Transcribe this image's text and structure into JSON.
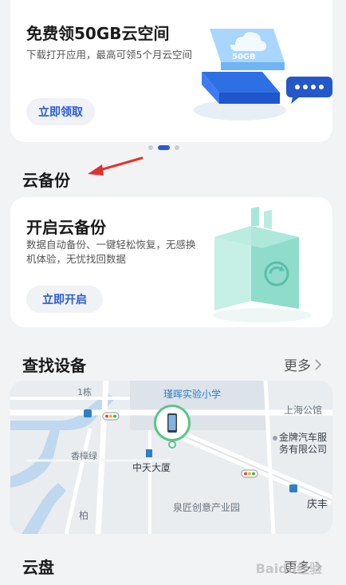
{
  "promo": {
    "title": "免费领50GB云空间",
    "description": "下载打开应用，最高可领5个月云空间",
    "button_label": "立即领取",
    "illustration_text": "50GB",
    "carousel": {
      "count": 3,
      "active_index": 1
    }
  },
  "backup_section": {
    "title": "云备份",
    "card": {
      "title": "开启云备份",
      "description": "数据自动备份、一键轻松恢复，无感换机体验，无忧找回数据",
      "button_label": "立即开启"
    }
  },
  "find_device": {
    "title": "查找设备",
    "more_label": "更多",
    "map": {
      "labels": {
        "building_1": "1栋",
        "school": "瑾晖实验小学",
        "shanghai": "上海公馆",
        "auto_service": "金牌汽车服务有限公司",
        "tower": "中天大厦",
        "xiangshu": "香樟绿",
        "industrial_park": "泉匠创意产业园",
        "road_qingfeng": "庆丰",
        "road_bo": "柏"
      }
    }
  },
  "cloud_drive": {
    "title": "云盘",
    "more_label": "更多"
  },
  "watermark": "Baidu经验",
  "colors": {
    "accent": "#2a5bd7",
    "background": "#f1f3f5",
    "arrow": "#e3312d"
  }
}
